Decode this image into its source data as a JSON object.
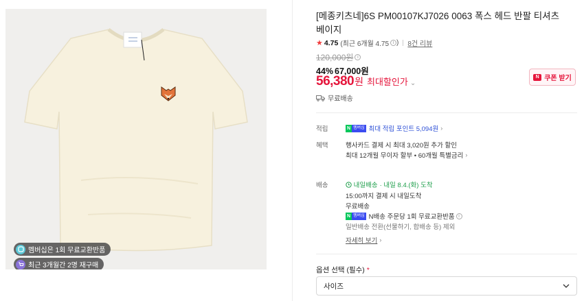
{
  "gallery": {
    "badges": [
      {
        "icon": "membership-icon",
        "text": "멤버십은 1회 무료교환반품"
      },
      {
        "icon": "cart-icon",
        "text": "최근 3개월간 2명 재구매"
      }
    ],
    "image": "cream-t-shirt-with-fox-head-patch"
  },
  "product": {
    "title": "[메종키츠네]6S PM00107KJ7026 0063 폭스 헤드 반팔 티셔츠 베이지",
    "rating": {
      "score": "4.75",
      "recent": "(최근 6개월 4.75",
      "recent_close": ")",
      "reviews": "8건 리뷰"
    },
    "price": {
      "original": "120,000원",
      "discount_pct": "44%",
      "sale": "67,000원",
      "max_number": "56,380",
      "max_won": "원",
      "max_label": "최대할인가"
    },
    "coupon": "쿠폰 받기",
    "shipping": "무료배송"
  },
  "benefits": {
    "points_label": "적립",
    "points_badge": {
      "n": "N",
      "m": "멤버십"
    },
    "points_text": "최대 적립 포인트 5,094원",
    "card_label": "혜택",
    "card_line1": "행사카드 결제 시 최대 3,020원 추가 할인",
    "card_line2": "최대 12개월 무이자 할부 • 60개월 특별금리"
  },
  "delivery": {
    "label": "배송",
    "arrival_badge": "내일배송",
    "arrival_text": "· 내일 8.4.(화) 도착",
    "cutoff": "15:00까지 결제 시 내일도착",
    "free": "무료배송",
    "return_badge": {
      "n": "N",
      "m": "멤버십"
    },
    "return_text": "N배송 주문당 1회 무료교환반품",
    "return_note": "일반배송 전환(선물하기, 합배송 등) 제외",
    "details": "자세히 보기"
  },
  "options": {
    "label": "옵션 선택 (필수)",
    "required_mark": "*",
    "select_value": "사이즈"
  },
  "colors": {
    "accent_red": "#e5153b",
    "naver_green": "#03c75a",
    "membership_blue": "#3b4cf0"
  }
}
